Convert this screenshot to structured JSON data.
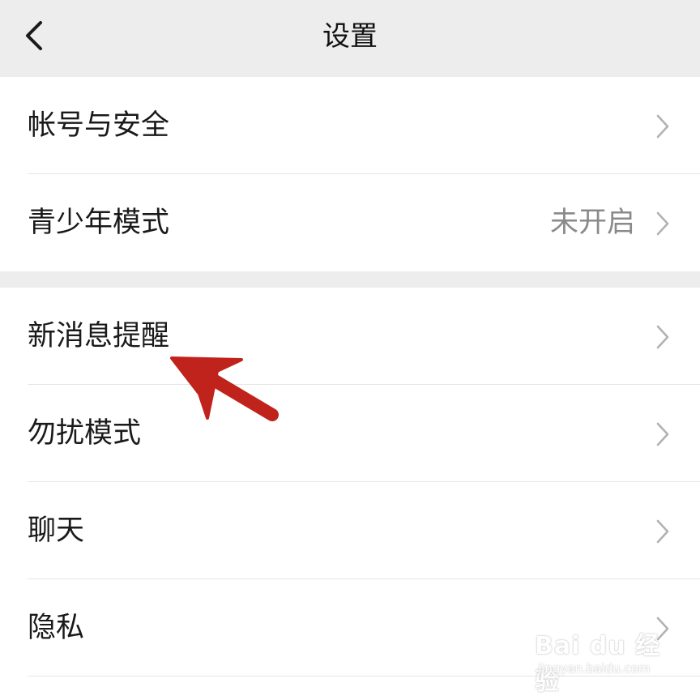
{
  "nav": {
    "title": "设置",
    "back_icon": "chevron-left-icon"
  },
  "groups": [
    {
      "items": [
        {
          "label": "帐号与安全",
          "value": ""
        },
        {
          "label": "青少年模式",
          "value": "未开启"
        }
      ]
    },
    {
      "items": [
        {
          "label": "新消息提醒",
          "value": ""
        },
        {
          "label": "勿扰模式",
          "value": ""
        },
        {
          "label": "聊天",
          "value": ""
        },
        {
          "label": "隐私",
          "value": ""
        }
      ]
    }
  ],
  "row_icon": "chevron-right-icon",
  "annotation": {
    "color": "#c0231b",
    "icon": "red-arrow-annotation"
  },
  "watermark": {
    "logo": "Bai du 经验",
    "url": "jingyan.baidu.com"
  }
}
